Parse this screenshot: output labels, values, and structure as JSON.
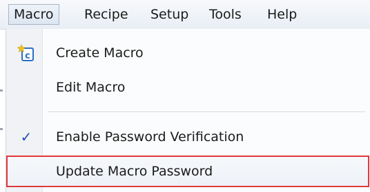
{
  "menubar": {
    "items": [
      {
        "label": "Macro",
        "active": true
      },
      {
        "label": "Recipe"
      },
      {
        "label": "Setup"
      },
      {
        "label": "Tools"
      },
      {
        "label": "Help"
      }
    ]
  },
  "macro_menu": {
    "items": [
      {
        "label": "Create Macro",
        "icon": "create-macro-icon"
      },
      {
        "label": "Edit Macro"
      },
      {
        "label": "Enable Password Verification",
        "checked": true,
        "icon": "checkmark-icon"
      },
      {
        "label": "Update Macro Password",
        "highlighted": true
      }
    ]
  },
  "colors": {
    "highlight_border": "#e1383a",
    "check": "#1a4fb5",
    "icon_yellow": "#f2c21b",
    "icon_blue": "#2b6fc5"
  }
}
